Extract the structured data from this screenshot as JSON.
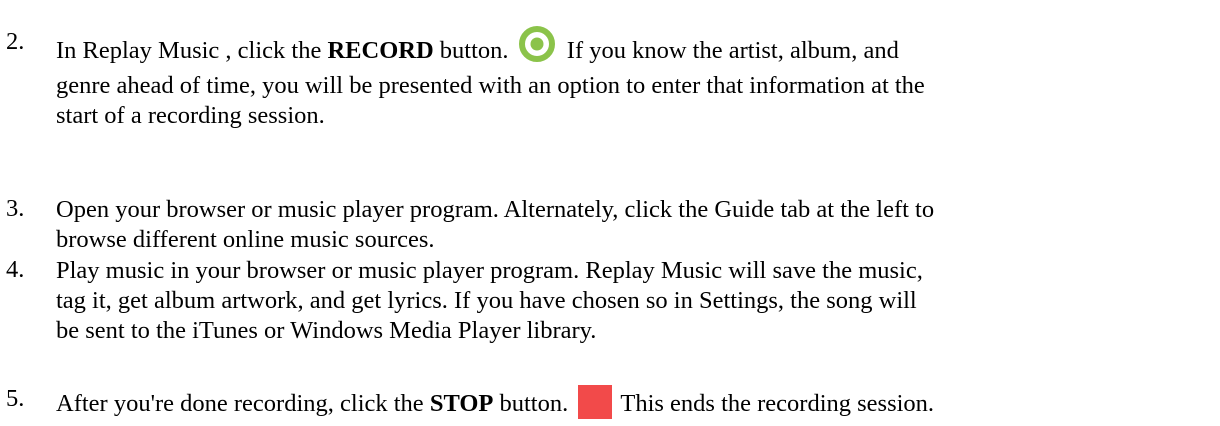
{
  "steps": [
    {
      "number": "2.",
      "lines": [
        [
          "In Replay Music , click the ",
          "RECORD",
          " button.",
          "If you know the artist, album, and"
        ],
        "genre ahead of time, you will be presented with an option to enter that information at the",
        "start of a recording session."
      ]
    },
    {
      "number": "3.",
      "lines": [
        "Open your browser or music player program. Alternately, click the Guide tab at the left to",
        "browse different online music sources."
      ]
    },
    {
      "number": "4.",
      "lines": [
        "Play music in your browser or music player program. Replay Music will save the music,",
        "tag it, get album artwork, and get lyrics. If you have chosen so in Settings, the song will",
        "be sent to the iTunes or Windows Media Player library."
      ]
    },
    {
      "number": "5.",
      "lines": [
        [
          "After you're done recording, click the ",
          "STOP",
          " button.",
          "This ends the recording session."
        ]
      ]
    }
  ],
  "icons": {
    "record": "record-button-icon",
    "stop": "stop-button-icon"
  },
  "colors": {
    "record_ring": "#8bc34a",
    "record_center": "#8bc34a",
    "stop_square": "#f24a4a"
  }
}
